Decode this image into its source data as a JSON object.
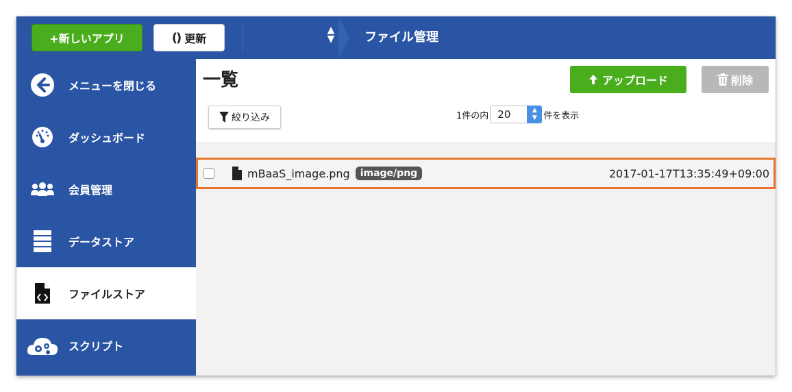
{
  "topbar": {
    "new_app_label": "+新しいアプリ",
    "refresh_icon": "()",
    "refresh_label": "更新",
    "title": "ファイル管理"
  },
  "sidebar": {
    "items": [
      {
        "label": "メニューを閉じる",
        "icon": "arrow-left-circle-icon"
      },
      {
        "label": "ダッシュボード",
        "icon": "gauge-icon"
      },
      {
        "label": "会員管理",
        "icon": "users-icon"
      },
      {
        "label": "データストア",
        "icon": "database-icon"
      },
      {
        "label": "ファイルストア",
        "icon": "file-code-icon"
      },
      {
        "label": "スクリプト",
        "icon": "cloud-gear-icon"
      }
    ],
    "active_index": 4
  },
  "main": {
    "title": "一覧",
    "upload_label": "アップロード",
    "delete_label": "削除",
    "filter_label": "絞り込み",
    "paging": {
      "prefix": "1件の内",
      "value": "20",
      "suffix": "件を表示"
    },
    "files": [
      {
        "name": "mBaaS_image.png",
        "mime": "image/png",
        "date": "2017-01-17T13:35:49+09:00"
      }
    ]
  },
  "colors": {
    "brand_blue": "#2a55a4",
    "green": "#4aad1e",
    "highlight": "#e9742c"
  }
}
